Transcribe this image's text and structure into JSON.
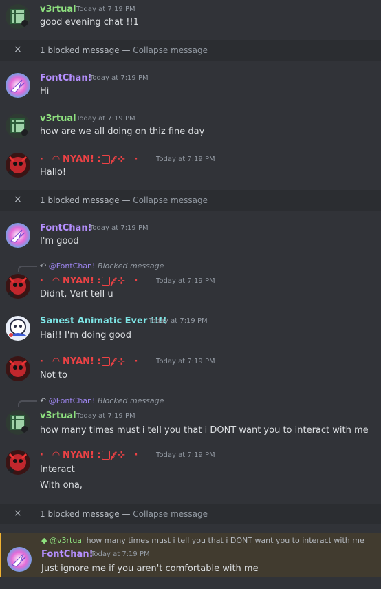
{
  "messages": [
    {
      "user": "v3rtual",
      "time": "Today at 7:19 PM",
      "text": "good evening chat !!1"
    },
    {
      "user": "FontChan!",
      "time": "Today at 7:19 PM",
      "text": "Hi"
    },
    {
      "user": "v3rtual",
      "time": "Today at 7:19 PM",
      "text": "how are we all doing on thiz fine day"
    },
    {
      "user": "NYAN! :",
      "time": "Today at 7:19 PM",
      "text": "Hallo!"
    },
    {
      "user": "FontChan!",
      "time": "Today at 7:19 PM",
      "text": "I'm good"
    },
    {
      "user": "NYAN! :",
      "time": "Today at 7:19 PM",
      "text": "Didnt, Vert tell u",
      "reply_to": "@FontChan!",
      "reply_text": "Blocked message"
    },
    {
      "user": "Sanest Animatic Ever !!!!",
      "time": "Today at 7:19 PM",
      "text": "Hai!! I'm doing good"
    },
    {
      "user": "NYAN! :",
      "time": "Today at 7:19 PM",
      "text": "Not to"
    },
    {
      "user": "v3rtual",
      "time": "Today at 7:19 PM",
      "text": "how many times must i tell you that i DONT want you to interact with me",
      "reply_to": "@FontChan!",
      "reply_text": "Blocked message"
    },
    {
      "user": "NYAN! :",
      "time": "Today at 7:19 PM",
      "text": "Interact",
      "text2": "With ona,"
    },
    {
      "user": "FontChan!",
      "time": "Today at 7:19 PM",
      "text": "Just ignore me if you aren't comfortable with me",
      "reply_to": "@v3rtual",
      "reply_text": "how many times must i tell you that i DONT want you to interact with me"
    }
  ],
  "blocked": {
    "label": "1 blocked message",
    "sep": "—",
    "action": "Collapse message",
    "close": "×"
  },
  "colors": {
    "bg": "#313338",
    "blocked_bg": "#2b2d31",
    "v3rtual": "#8ee07f",
    "fontchan": "#b58fff",
    "nyan": "#ed4245",
    "sanest": "#7ee6e6",
    "mention": "#413b2f"
  }
}
